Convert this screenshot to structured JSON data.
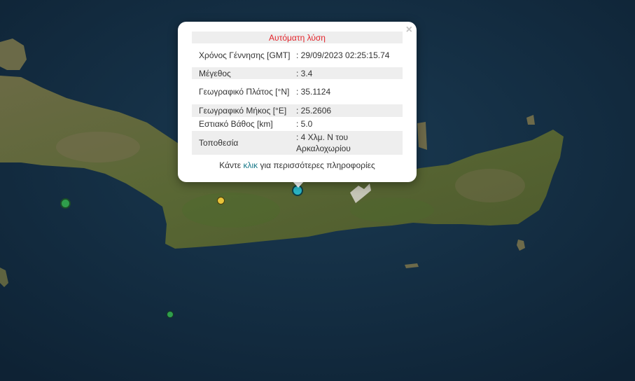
{
  "popup": {
    "title": "Αυτόματη λύση",
    "rows": [
      {
        "label": "Χρόνος Γέννησης [GMT]",
        "value": ": 29/09/2023 02:25:15.74"
      },
      {
        "label": "Μέγεθος",
        "value": ": 3.4"
      },
      {
        "label": "Γεωγραφικό Πλάτος [°N]",
        "value": ": 35.1124"
      },
      {
        "label": "Γεωγραφικό Μήκος [°E]",
        "value": ": 25.2606"
      },
      {
        "label": "Εστιακό Βάθος [km]",
        "value": ": 5.0"
      },
      {
        "label": "Τοποθεσία",
        "value": ": 4 Χλμ. Ν του Αρκαλοχωρίου"
      }
    ],
    "more_before": "Κάντε ",
    "more_link": "κλικ",
    "more_after": " για περισσότερες πληροφορίες",
    "close_symbol": "×"
  },
  "colors": {
    "sea": "#11283c",
    "land": "#5a6a34",
    "marker_selected": "#29b5c4",
    "marker_yellow": "#e8c33a",
    "marker_green": "#2f9e4c"
  },
  "icons": {
    "close": "close-icon"
  }
}
